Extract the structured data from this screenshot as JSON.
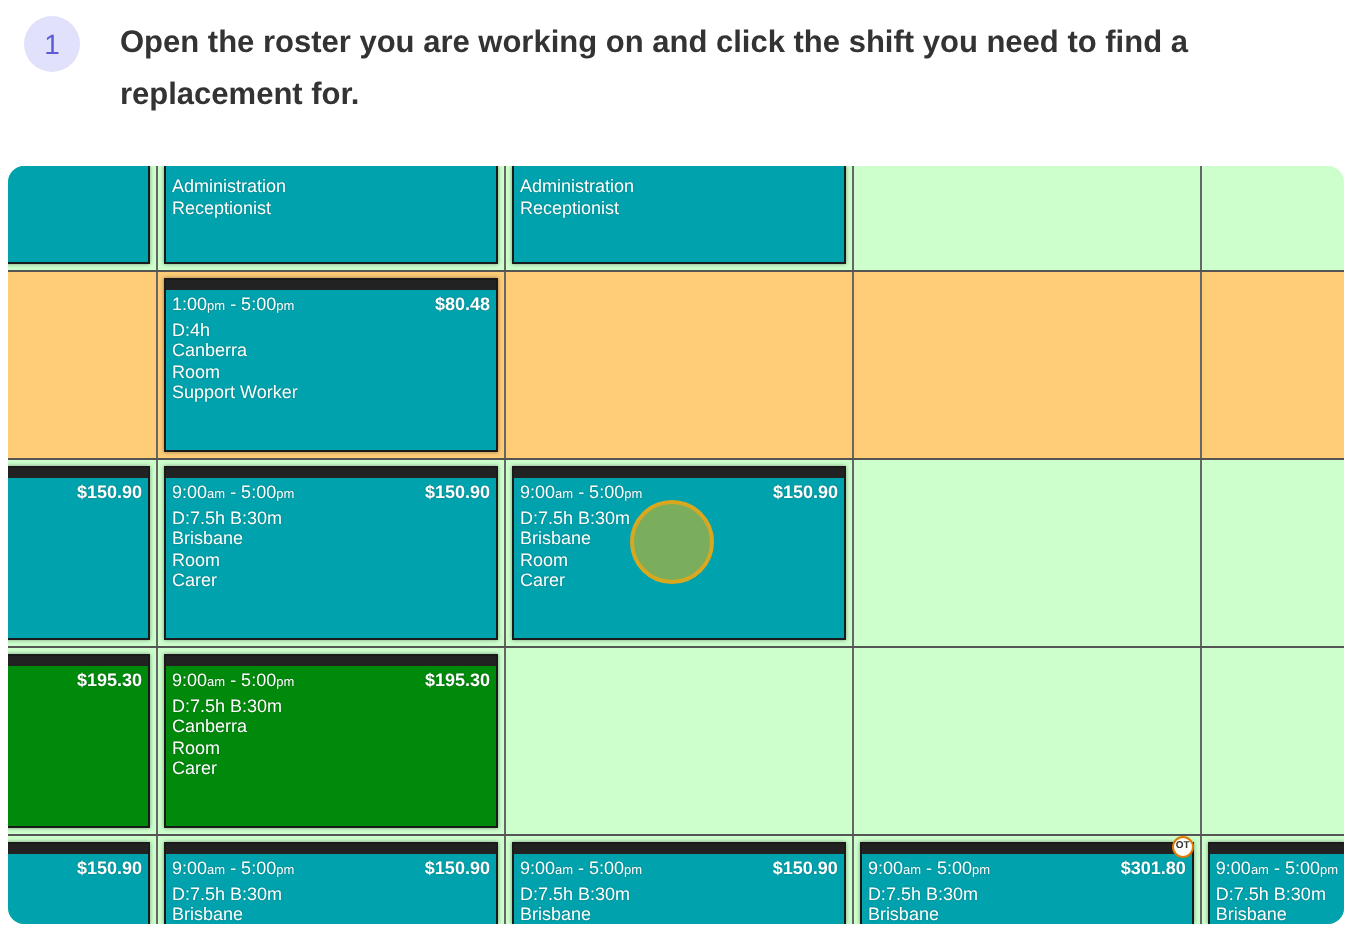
{
  "step": {
    "number": "1",
    "text": "Open the roster you are working on and click the shift you need to find a replacement for."
  },
  "roster": {
    "rows": [
      {
        "color": "#ccffcc",
        "cells": [
          {
            "kind": "shift",
            "color": "#00a3ad",
            "clicked": false
          },
          {
            "kind": "shift",
            "color": "#00a3ad",
            "clicked": false,
            "lines": [
              "Administration",
              "Receptionist"
            ]
          },
          {
            "kind": "shift",
            "color": "#00a3ad",
            "clicked": false,
            "lines": [
              "Administration",
              "Receptionist"
            ]
          },
          {
            "kind": "empty"
          },
          {
            "kind": "empty"
          }
        ]
      },
      {
        "color": "#ffcc77",
        "cells": [
          {
            "kind": "empty"
          },
          {
            "kind": "shift",
            "color": "#00a3ad",
            "clicked": false,
            "time": "1:00$_{pm}$ - 5:00$_{pm}$",
            "price": "$80.48",
            "lines": [
              "D:4h",
              "Canberra",
              "Room",
              "Support Worker"
            ]
          },
          {
            "kind": "empty"
          },
          {
            "kind": "empty"
          },
          {
            "kind": "empty"
          }
        ]
      },
      {
        "color": "#ccffcc",
        "cells": [
          {
            "kind": "shift",
            "color": "#00a3ad",
            "clicked": false,
            "price": "$150.90"
          },
          {
            "kind": "shift",
            "color": "#00a3ad",
            "clicked": false,
            "time": "9:00$_{am}$ - 5:00$_{pm}$",
            "price": "$150.90",
            "lines": [
              "D:7.5h B:30m",
              "Brisbane",
              "Room",
              "Carer"
            ]
          },
          {
            "kind": "shift",
            "color": "#00a3ad",
            "clicked": true,
            "time": "9:00$_{am}$ - 5:00$_{pm}$",
            "price": "$150.90",
            "lines": [
              "D:7.5h B:30m",
              "Brisbane",
              "Room",
              "Carer"
            ]
          },
          {
            "kind": "empty"
          },
          {
            "kind": "empty"
          }
        ]
      },
      {
        "color": "#ccffcc",
        "cells": [
          {
            "kind": "shift",
            "color": "#008a0c",
            "clicked": false,
            "price": "$195.30"
          },
          {
            "kind": "shift",
            "color": "#008a0c",
            "clicked": false,
            "time": "9:00$_{am}$ - 5:00$_{pm}$",
            "price": "$195.30",
            "lines": [
              "D:7.5h B:30m",
              "Canberra",
              "Room",
              "Carer"
            ]
          },
          {
            "kind": "empty"
          },
          {
            "kind": "empty"
          },
          {
            "kind": "empty"
          }
        ]
      },
      {
        "color": "#ccffcc",
        "cells": [
          {
            "kind": "shift",
            "color": "#00a3ad",
            "clicked": false,
            "price": "$150.90"
          },
          {
            "kind": "shift",
            "color": "#00a3ad",
            "clicked": false,
            "time": "9:00$_{am}$ - 5:00$_{pm}$",
            "price": "$150.90",
            "lines": [
              "D:7.5h B:30m",
              "Brisbane"
            ]
          },
          {
            "kind": "shift",
            "color": "#00a3ad",
            "clicked": false,
            "time": "9:00$_{am}$ - 5:00$_{pm}$",
            "price": "$150.90",
            "lines": [
              "D:7.5h B:30m",
              "Brisbane"
            ]
          },
          {
            "kind": "shift",
            "color": "#00a3ad",
            "clicked": false,
            "badge": "OT",
            "time": "9:00$_{am}$ - 5:00$_{pm}$",
            "price": "$301.80",
            "lines": [
              "D:7.5h B:30m",
              "Brisbane"
            ]
          },
          {
            "kind": "shift",
            "color": "#00a3ad",
            "clicked": false,
            "time": "9:00$_{am}$ - 5:00$_{pm}$",
            "lines": [
              "D:7.5h B:30m",
              "Brisbane"
            ]
          }
        ]
      }
    ]
  }
}
